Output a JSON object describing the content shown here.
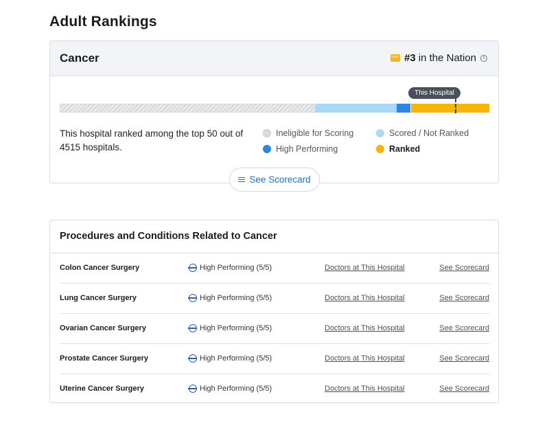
{
  "page": {
    "title": "Adult Rankings"
  },
  "specialty_card": {
    "title": "Cancer",
    "rank_number": "#3",
    "rank_text": "in the Nation",
    "info_icon": "info-icon",
    "medal_icon": "medal-icon",
    "marker_label": "This Hospital",
    "summary": "This hospital ranked among the top 50 out of 4515 hospitals.",
    "legend": {
      "ineligible": "Ineligible for Scoring",
      "scored": "Scored / Not Ranked",
      "high": "High Performing",
      "ranked": "Ranked"
    },
    "scorecard_button": "See Scorecard",
    "colors": {
      "ranked": "#f5b50a",
      "high": "#2f86e0",
      "scored": "#abd8f6",
      "ineligible": "#d3d5d9"
    }
  },
  "procedures_card": {
    "title": "Procedures and Conditions Related to Cancer",
    "rows": [
      {
        "name": "Colon Cancer Surgery",
        "status": "High Performing (5/5)",
        "doctors": "Doctors at This Hospital",
        "scorecard": "See Scorecard"
      },
      {
        "name": "Lung Cancer Surgery",
        "status": "High Performing (5/5)",
        "doctors": "Doctors at This Hospital",
        "scorecard": "See Scorecard"
      },
      {
        "name": "Ovarian Cancer Surgery",
        "status": "High Performing (5/5)",
        "doctors": "Doctors at This Hospital",
        "scorecard": "See Scorecard"
      },
      {
        "name": "Prostate Cancer Surgery",
        "status": "High Performing (5/5)",
        "doctors": "Doctors at This Hospital",
        "scorecard": "See Scorecard"
      },
      {
        "name": "Uterine Cancer Surgery",
        "status": "High Performing (5/5)",
        "doctors": "Doctors at This Hospital",
        "scorecard": "See Scorecard"
      }
    ]
  }
}
